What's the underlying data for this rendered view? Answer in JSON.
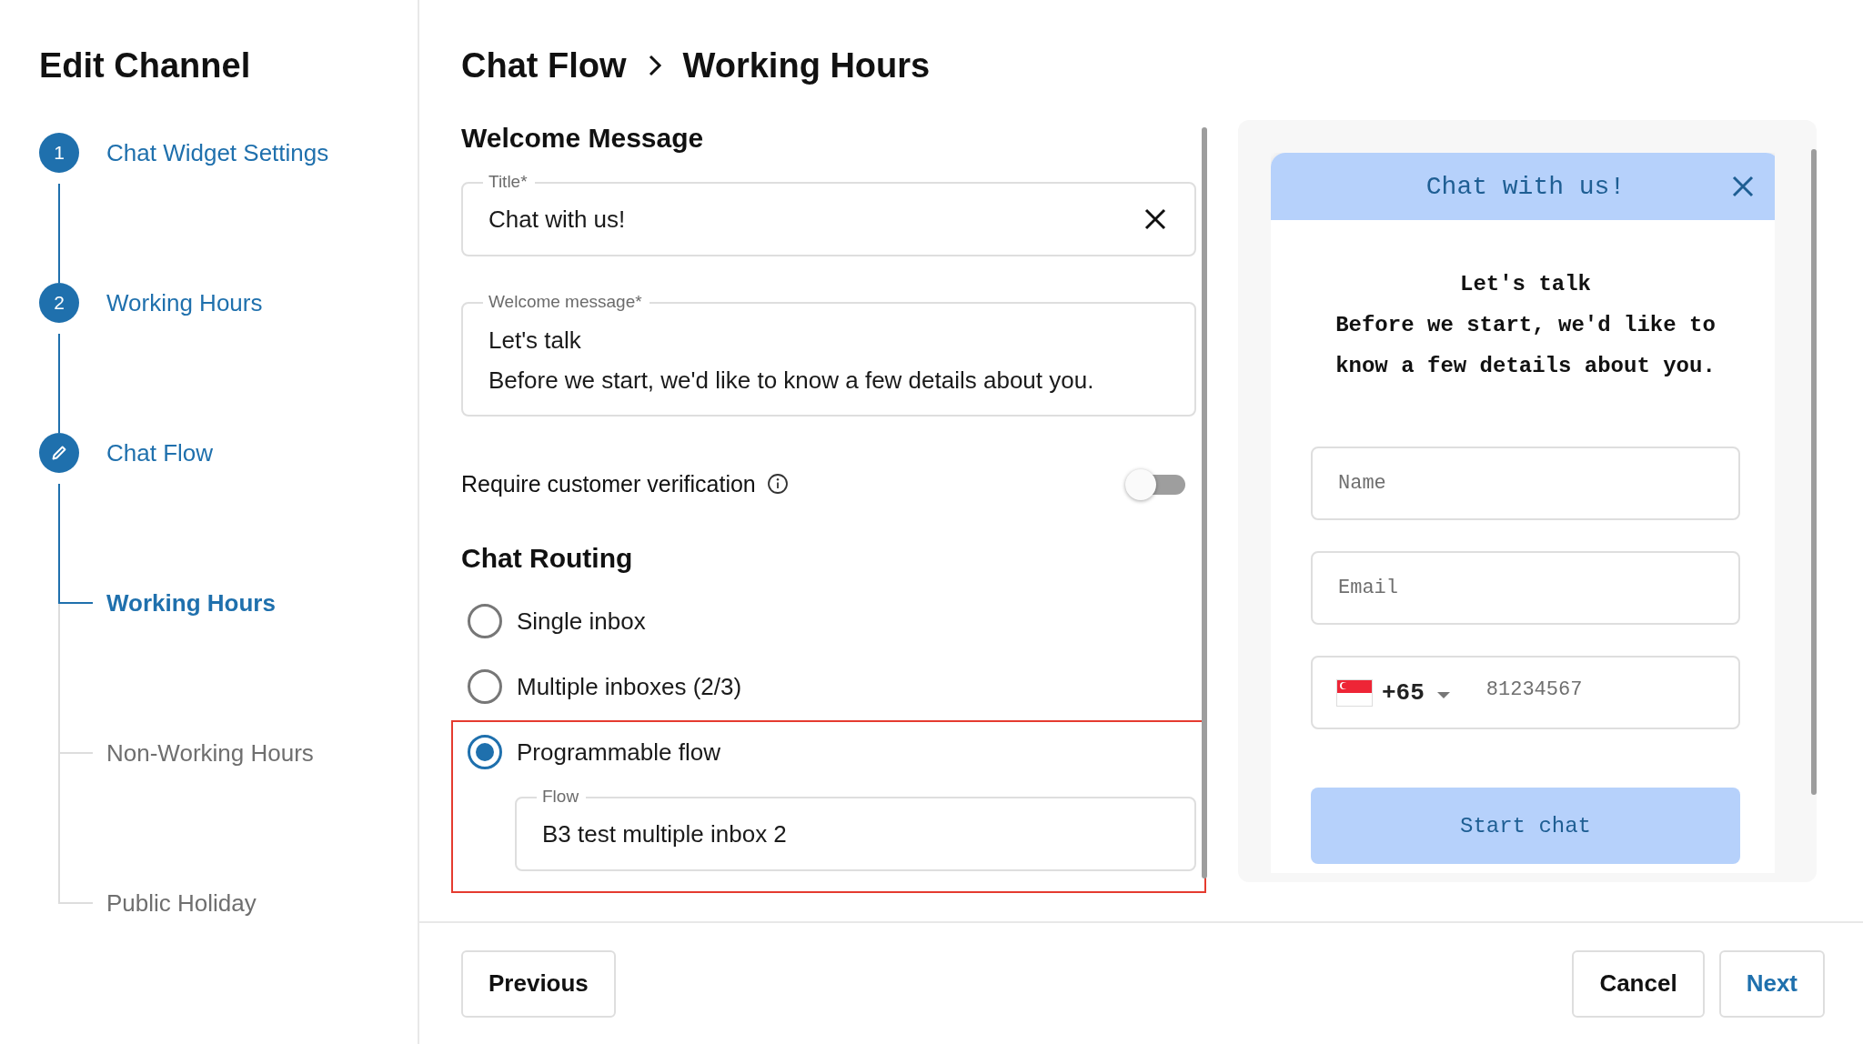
{
  "sidebar": {
    "title": "Edit Channel",
    "steps": [
      {
        "kind": "number",
        "number": "1",
        "label": "Chat Widget Settings"
      },
      {
        "kind": "number",
        "number": "2",
        "label": "Working Hours"
      },
      {
        "kind": "edit",
        "label": "Chat Flow",
        "children": [
          {
            "label": "Working Hours",
            "selected": true
          },
          {
            "label": "Non-Working Hours",
            "selected": false
          },
          {
            "label": "Public Holiday",
            "selected": false
          }
        ]
      }
    ]
  },
  "breadcrumb": [
    "Chat Flow",
    "Working Hours"
  ],
  "welcome": {
    "heading": "Welcome Message",
    "title_field": {
      "label": "Title*",
      "value": "Chat with us!"
    },
    "message_field": {
      "label": "Welcome message*",
      "lines": [
        "Let's talk",
        "Before we start, we'd like to know a few details about you."
      ]
    },
    "verification": {
      "label": "Require customer verification",
      "on": false
    }
  },
  "routing": {
    "heading": "Chat Routing",
    "options": [
      {
        "label": "Single inbox",
        "selected": false,
        "highlighted": false
      },
      {
        "label": "Multiple inboxes (2/3)",
        "selected": false,
        "highlighted": false
      },
      {
        "label": "Programmable flow",
        "selected": true,
        "highlighted": true,
        "field": {
          "label": "Flow",
          "value": "B3 test multiple inbox 2"
        }
      }
    ]
  },
  "preview": {
    "title": "Chat with us!",
    "message": [
      "Let's talk",
      "Before we start, we'd like to know a few details about you."
    ],
    "name_placeholder": "Name",
    "email_placeholder": "Email",
    "country_code": "+65",
    "phone_placeholder": "81234567",
    "button": "Start chat"
  },
  "footer": {
    "previous": "Previous",
    "cancel": "Cancel",
    "next": "Next"
  }
}
